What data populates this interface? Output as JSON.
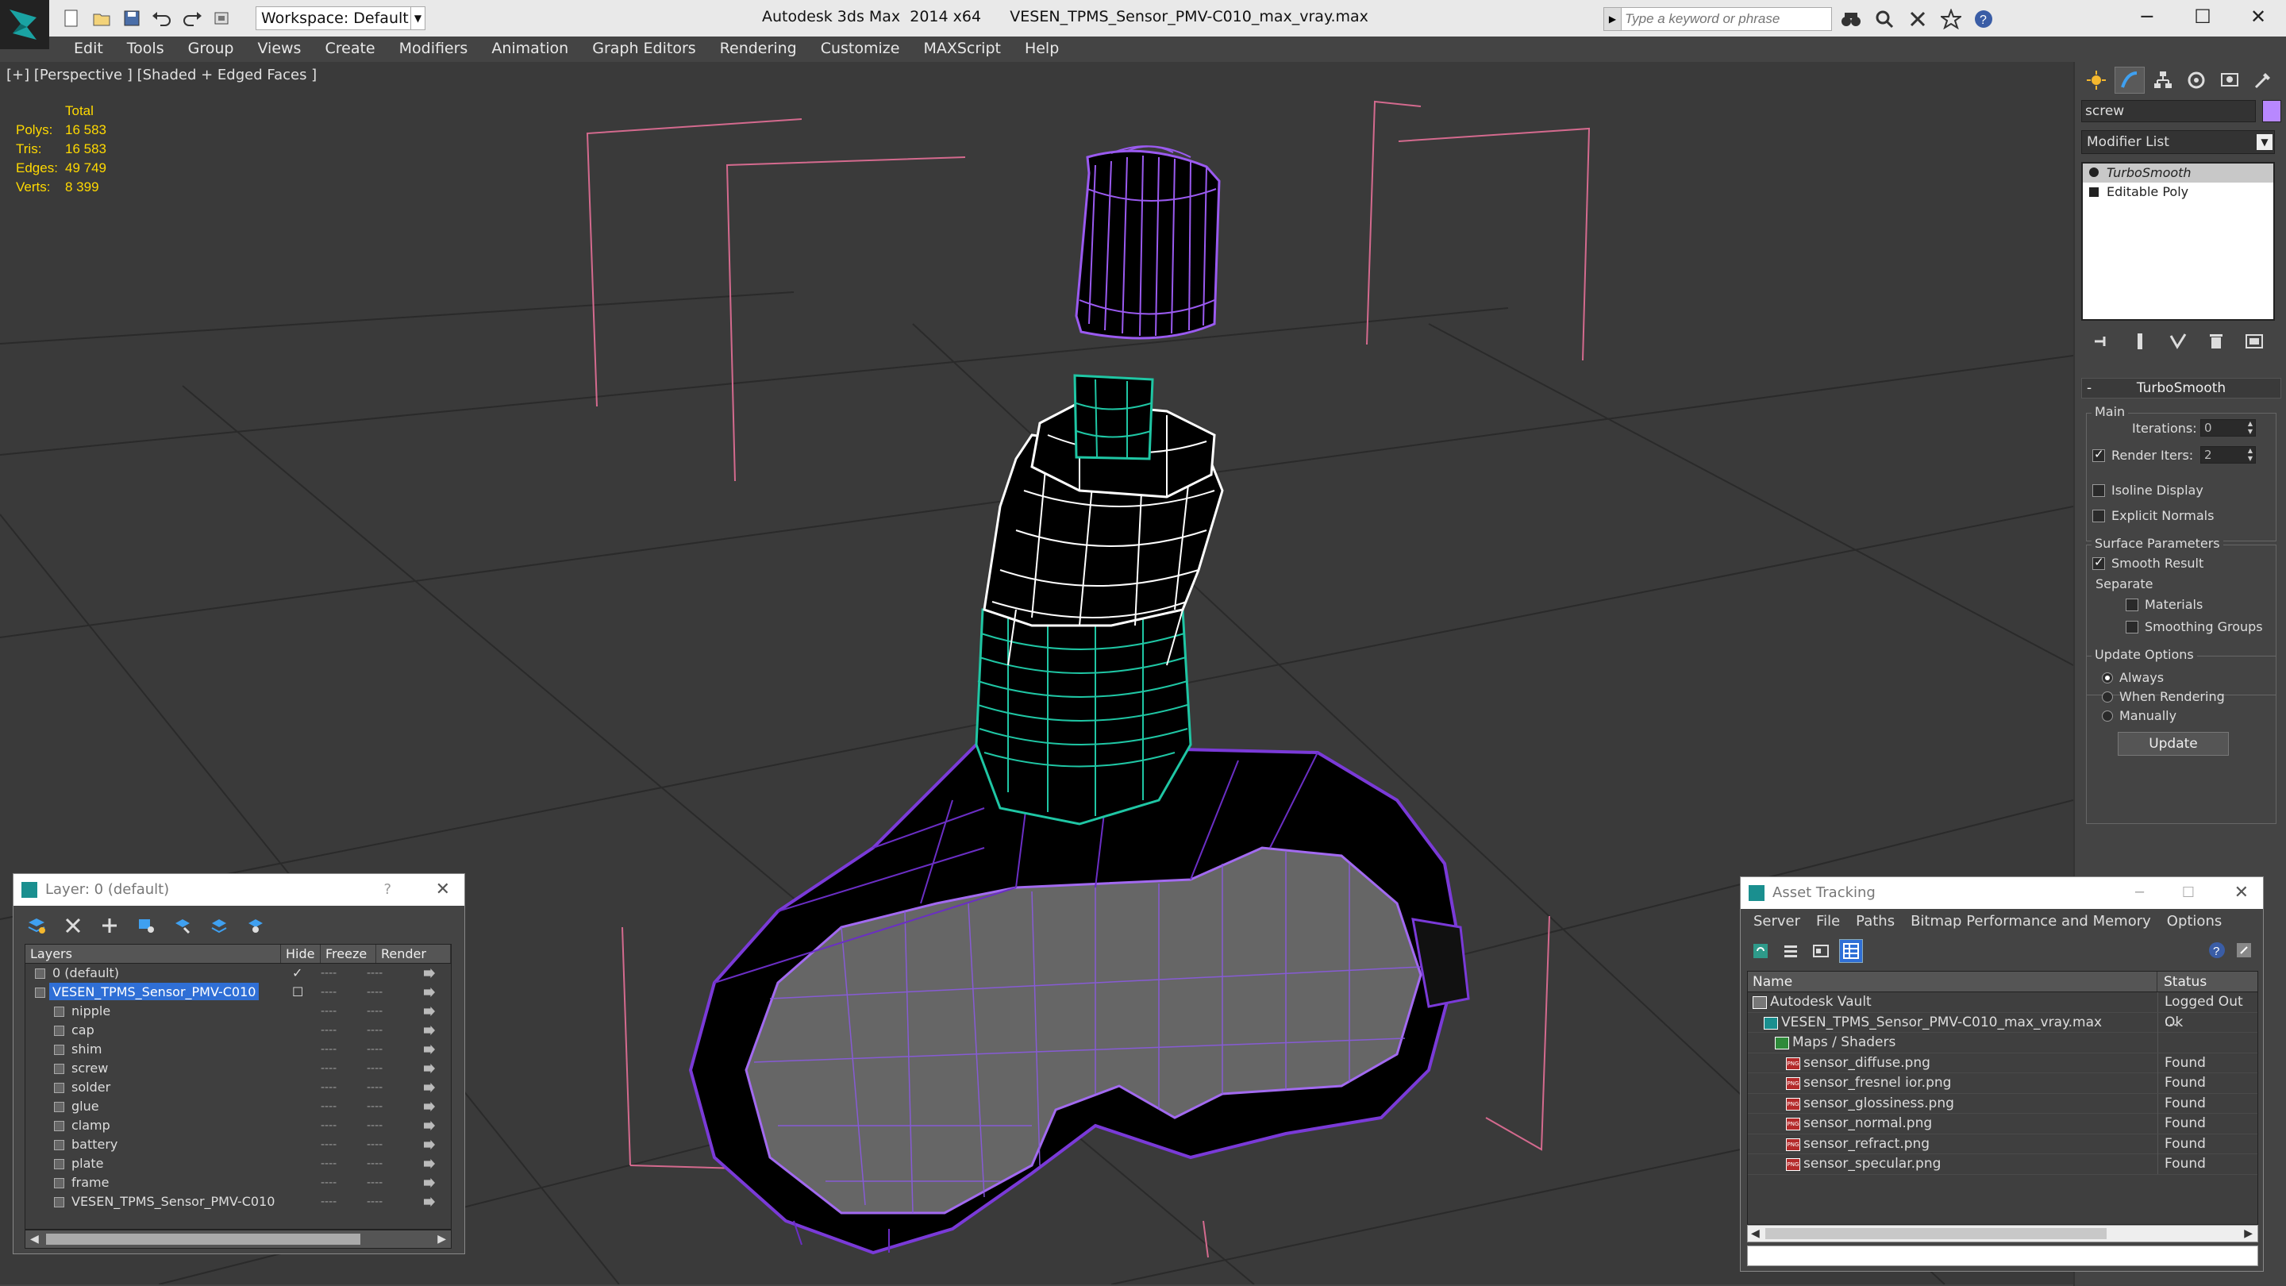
{
  "titlebar": {
    "workspace": "Workspace: Default",
    "app_title": "Autodesk 3ds Max  2014 x64      VESEN_TPMS_Sensor_PMV-C010_max_vray.max",
    "search_placeholder": "Type a keyword or phrase"
  },
  "menu": [
    "Edit",
    "Tools",
    "Group",
    "Views",
    "Create",
    "Modifiers",
    "Animation",
    "Graph Editors",
    "Rendering",
    "Customize",
    "MAXScript",
    "Help"
  ],
  "viewport": {
    "label": "[+] [Perspective ] [Shaded + Edged Faces ]",
    "stats": {
      "header": "Total",
      "rows": [
        {
          "label": "Polys:",
          "value": "16 583"
        },
        {
          "label": "Tris:",
          "value": "16 583"
        },
        {
          "label": "Edges:",
          "value": "49 749"
        },
        {
          "label": "Verts:",
          "value": "8 399"
        }
      ]
    }
  },
  "command_panel": {
    "object_name": "screw",
    "object_color": "#b888ff",
    "modifier_list": "Modifier List",
    "stack": [
      "TurboSmooth",
      "Editable Poly"
    ],
    "rollout": "TurboSmooth",
    "main_group": "Main",
    "iterations_label": "Iterations:",
    "iterations_value": "0",
    "render_iters_label": "Render Iters:",
    "render_iters_value": "2",
    "isoline_display": "Isoline Display",
    "explicit_normals": "Explicit Normals",
    "surface_params": "Surface Parameters",
    "smooth_result": "Smooth Result",
    "separate": "Separate",
    "materials": "Materials",
    "smoothing_groups": "Smoothing Groups",
    "update_options": "Update Options",
    "always": "Always",
    "when_rendering": "When Rendering",
    "manually": "Manually",
    "update_button": "Update"
  },
  "layer_dialog": {
    "title": "Layer: 0 (default)",
    "help": "?",
    "columns": [
      "Layers",
      "Hide",
      "Freeze",
      "Render"
    ],
    "layers": [
      {
        "name": "0 (default)",
        "indent": 0
      },
      {
        "name": "VESEN_TPMS_Sensor_PMV-C010",
        "indent": 0
      },
      {
        "name": "nipple",
        "indent": 1
      },
      {
        "name": "cap",
        "indent": 1
      },
      {
        "name": "shim",
        "indent": 1
      },
      {
        "name": "screw",
        "indent": 1
      },
      {
        "name": "solder",
        "indent": 1
      },
      {
        "name": "glue",
        "indent": 1
      },
      {
        "name": "clamp",
        "indent": 1
      },
      {
        "name": "battery",
        "indent": 1
      },
      {
        "name": "plate",
        "indent": 1
      },
      {
        "name": "frame",
        "indent": 1
      },
      {
        "name": "VESEN_TPMS_Sensor_PMV-C010",
        "indent": 1
      }
    ],
    "dash": "----"
  },
  "asset_tracking": {
    "title": "Asset Tracking",
    "menu": [
      "Server",
      "File",
      "Paths",
      "Bitmap Performance and Memory",
      "Options"
    ],
    "columns": [
      "Name",
      "Status"
    ],
    "rows": [
      {
        "name": "Autodesk Vault",
        "status": "Logged Out ...",
        "indent": 0
      },
      {
        "name": "VESEN_TPMS_Sensor_PMV-C010_max_vray.max",
        "status": "Ok",
        "indent": 1
      },
      {
        "name": "Maps / Shaders",
        "status": "",
        "indent": 2
      },
      {
        "name": "sensor_diffuse.png",
        "status": "Found",
        "indent": 3
      },
      {
        "name": "sensor_fresnel ior.png",
        "status": "Found",
        "indent": 3
      },
      {
        "name": "sensor_glossiness.png",
        "status": "Found",
        "indent": 3
      },
      {
        "name": "sensor_normal.png",
        "status": "Found",
        "indent": 3
      },
      {
        "name": "sensor_refract.png",
        "status": "Found",
        "indent": 3
      },
      {
        "name": "sensor_specular.png",
        "status": "Found",
        "indent": 3
      }
    ],
    "png_badge": "PNG"
  }
}
